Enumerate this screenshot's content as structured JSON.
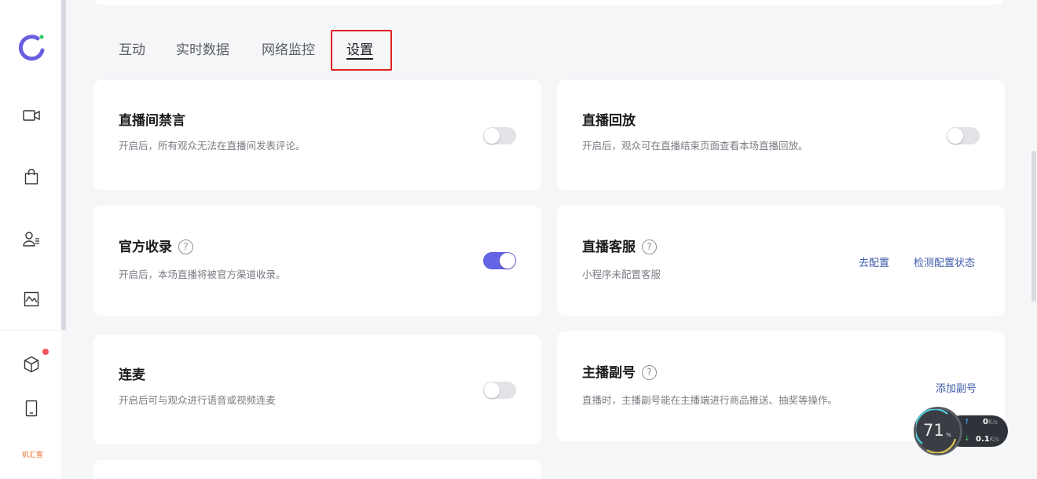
{
  "sidebar": {
    "icons": [
      "logo-icon",
      "video-camera-icon",
      "shopping-bag-icon",
      "user-list-icon",
      "chart-icon",
      "cube-icon",
      "mobile-phone-icon"
    ],
    "brand_text": "机汇客",
    "badge_color": "#f2545b"
  },
  "tabs": [
    {
      "label": "互动"
    },
    {
      "label": "实时数据"
    },
    {
      "label": "网络监控"
    },
    {
      "label": "设置"
    }
  ],
  "active_tab": "设置",
  "cards": {
    "mute": {
      "title": "直播间禁言",
      "desc": "开启后，所有观众无法在直播间发表评论。",
      "enabled": false
    },
    "replay": {
      "title": "直播回放",
      "desc": "开启后，观众可在直播结束页面查看本场直播回放。",
      "enabled": false
    },
    "official": {
      "title": "官方收录",
      "desc": "开启后，本场直播将被官方渠道收录。",
      "enabled": true
    },
    "service": {
      "title": "直播客服",
      "desc": "小程序未配置客服",
      "link1": "去配置",
      "link2": "检测配置状态"
    },
    "cohost": {
      "title": "连麦",
      "desc": "开启后可与观众进行语音或视频连麦",
      "enabled": false
    },
    "assistant": {
      "title": "主播副号",
      "desc": "直播时，主播副号能在主播端进行商品推送、抽奖等操作。",
      "link": "添加副号"
    }
  },
  "help_glyph": "?",
  "network": {
    "percent": "71",
    "percent_sign": "%",
    "upload_value": "0",
    "upload_unit": "K/s",
    "download_value": "0.1",
    "download_unit": "K/s"
  },
  "colors": {
    "toggle_on": "#6464e6",
    "link": "#3e5ba8",
    "highlight": "#e02020"
  }
}
